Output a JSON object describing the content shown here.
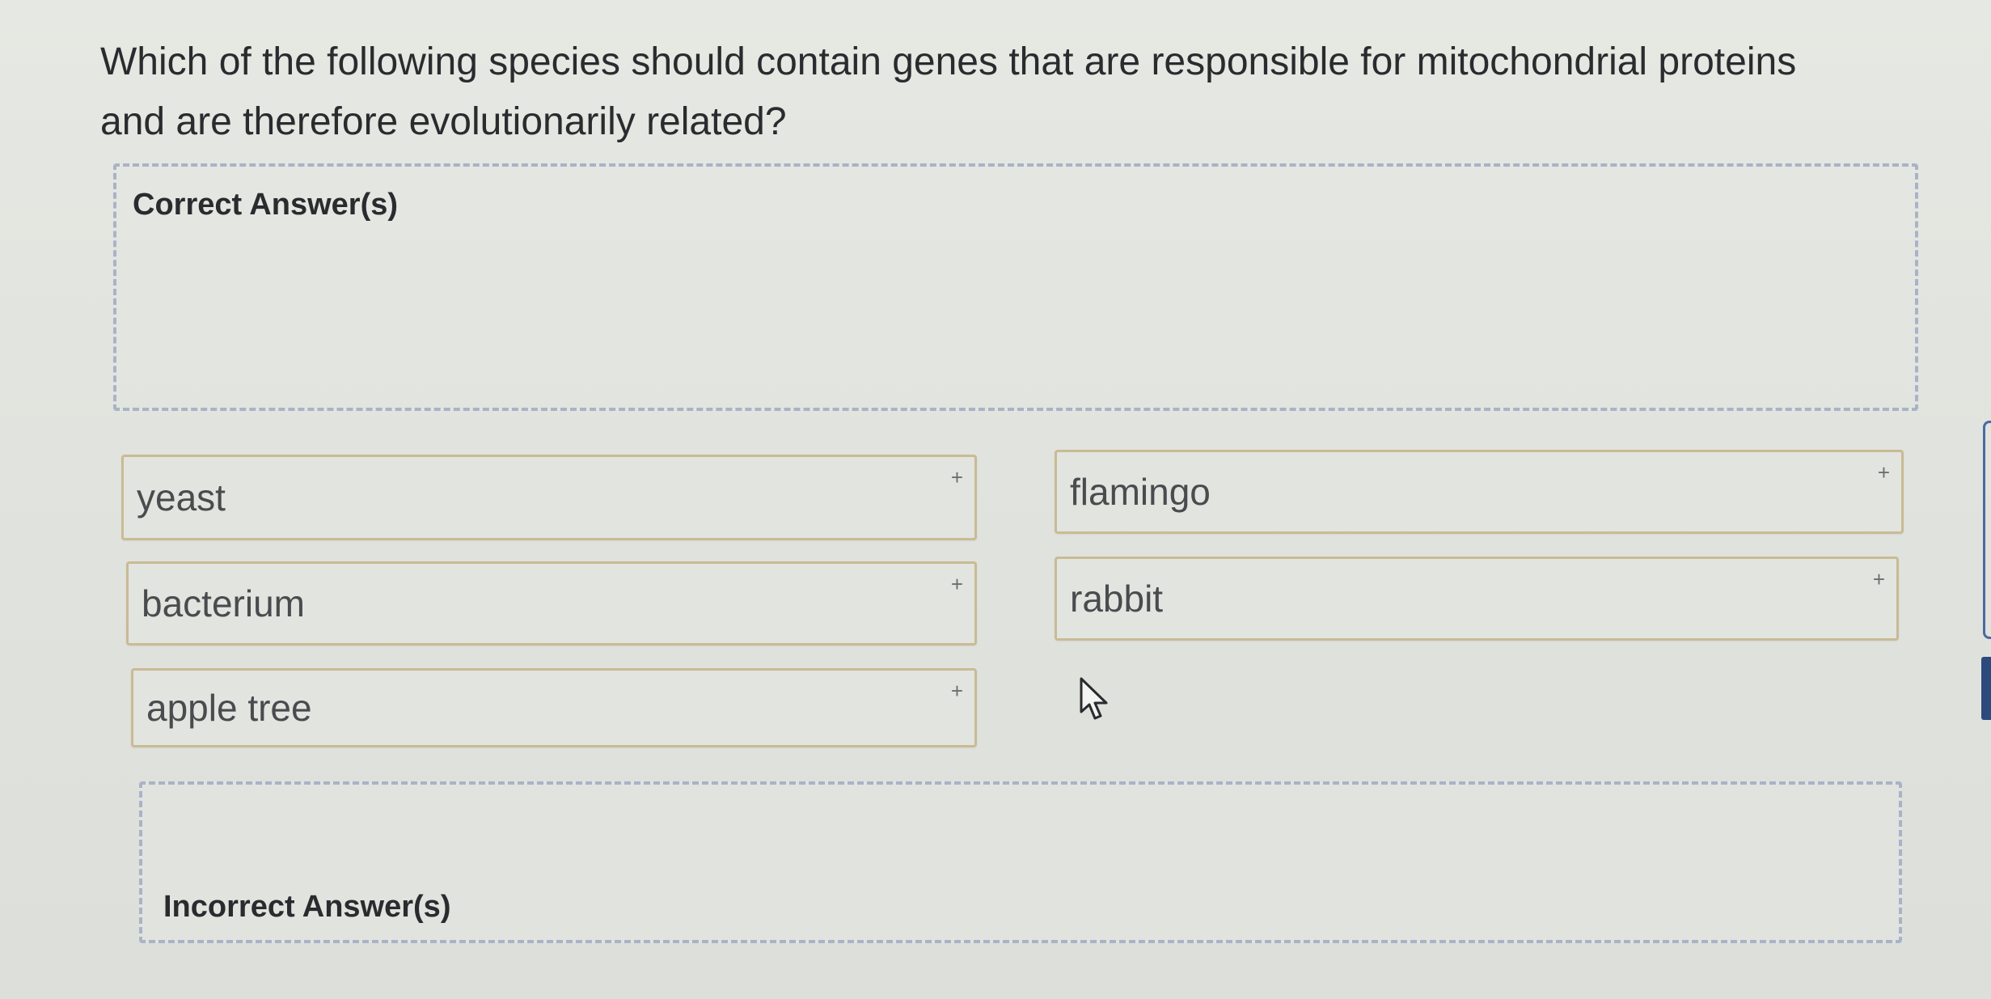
{
  "question": {
    "text": "Which of the following species should contain genes that are responsible for mitochondrial proteins and are therefore evolutionarily related?"
  },
  "drop_zones": {
    "correct_label": "Correct Answer(s)",
    "incorrect_label": "Incorrect Answer(s)"
  },
  "answer_choices": [
    {
      "label": "yeast"
    },
    {
      "label": "flamingo"
    },
    {
      "label": "bacterium"
    },
    {
      "label": "rabbit"
    },
    {
      "label": "apple tree"
    }
  ],
  "drag_handle_glyph": "+",
  "colors": {
    "background": "#e3e5e0",
    "chip_border": "#c9bb94",
    "dropzone_border": "#aab3c6",
    "text": "#2a2b2e"
  },
  "icons": [
    "drag-handle-icon",
    "mouse-cursor-icon"
  ]
}
